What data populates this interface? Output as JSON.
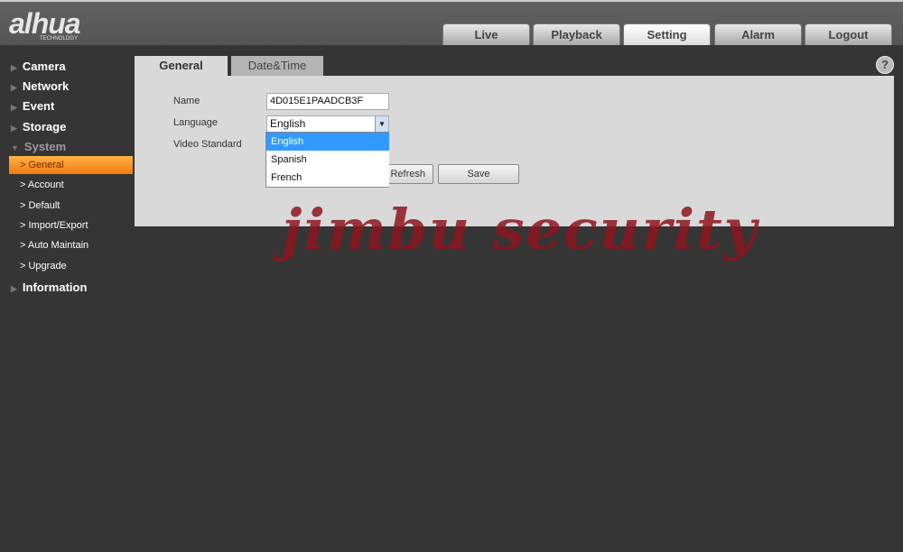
{
  "header": {
    "logo": "alhua",
    "logo_sub": "TECHNOLOGY",
    "nav": [
      "Live",
      "Playback",
      "Setting",
      "Alarm",
      "Logout"
    ],
    "active_nav": "Setting"
  },
  "sidebar": {
    "camera": "Camera",
    "network": "Network",
    "event": "Event",
    "storage": "Storage",
    "system": "System",
    "sub": [
      "General",
      "Account",
      "Default",
      "Import/Export",
      "Auto Maintain",
      "Upgrade"
    ],
    "information": "Information"
  },
  "tabs": {
    "general": "General",
    "datetime": "Date&Time"
  },
  "form": {
    "name_label": "Name",
    "name_value": "4D015E1PAADCB3F",
    "language_label": "Language",
    "language_value": "English",
    "video_label": "Video Standard",
    "options": [
      "English",
      "Spanish",
      "French"
    ],
    "refresh": "Refresh",
    "refresh_visible": "fresh",
    "save": "Save"
  },
  "watermark": "jimbu security",
  "colors": {
    "accent": "#f58a1f",
    "selected_option": "#3399ff"
  }
}
